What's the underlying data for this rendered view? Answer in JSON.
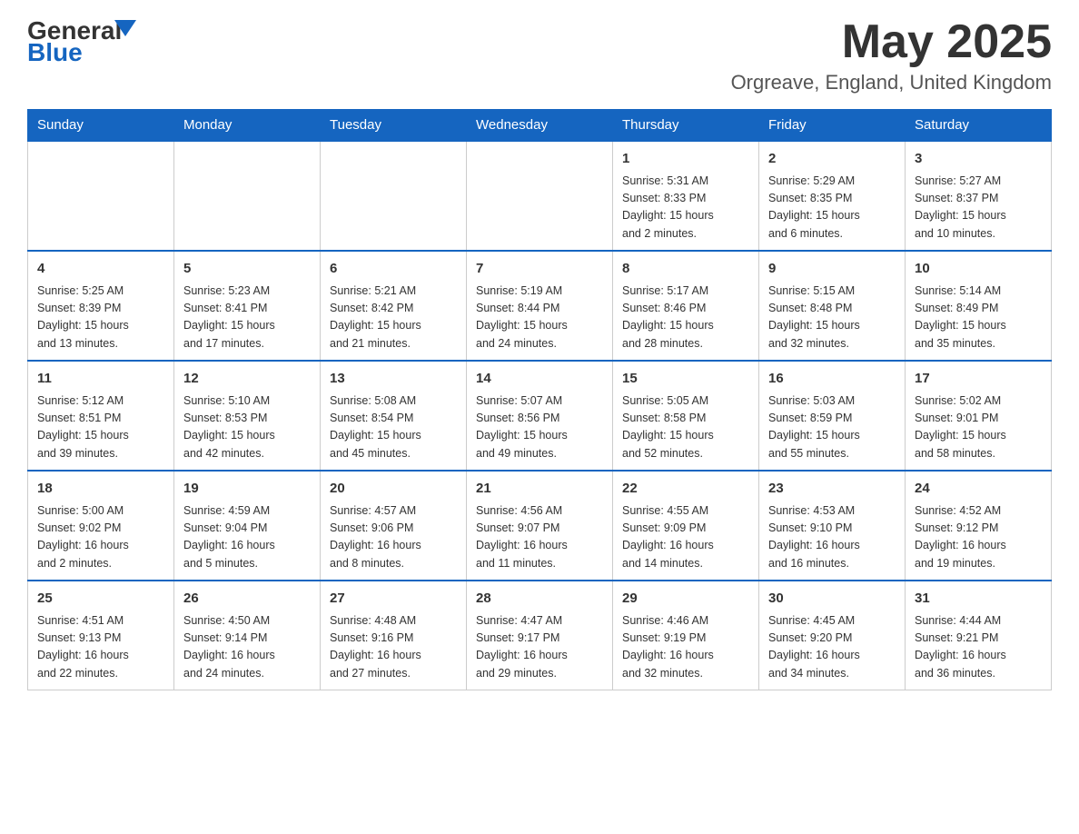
{
  "header": {
    "logo_general": "General",
    "logo_blue": "Blue",
    "month_title": "May 2025",
    "location": "Orgreave, England, United Kingdom"
  },
  "days_of_week": [
    "Sunday",
    "Monday",
    "Tuesday",
    "Wednesday",
    "Thursday",
    "Friday",
    "Saturday"
  ],
  "weeks": [
    [
      {
        "day": "",
        "info": ""
      },
      {
        "day": "",
        "info": ""
      },
      {
        "day": "",
        "info": ""
      },
      {
        "day": "",
        "info": ""
      },
      {
        "day": "1",
        "info": "Sunrise: 5:31 AM\nSunset: 8:33 PM\nDaylight: 15 hours\nand 2 minutes."
      },
      {
        "day": "2",
        "info": "Sunrise: 5:29 AM\nSunset: 8:35 PM\nDaylight: 15 hours\nand 6 minutes."
      },
      {
        "day": "3",
        "info": "Sunrise: 5:27 AM\nSunset: 8:37 PM\nDaylight: 15 hours\nand 10 minutes."
      }
    ],
    [
      {
        "day": "4",
        "info": "Sunrise: 5:25 AM\nSunset: 8:39 PM\nDaylight: 15 hours\nand 13 minutes."
      },
      {
        "day": "5",
        "info": "Sunrise: 5:23 AM\nSunset: 8:41 PM\nDaylight: 15 hours\nand 17 minutes."
      },
      {
        "day": "6",
        "info": "Sunrise: 5:21 AM\nSunset: 8:42 PM\nDaylight: 15 hours\nand 21 minutes."
      },
      {
        "day": "7",
        "info": "Sunrise: 5:19 AM\nSunset: 8:44 PM\nDaylight: 15 hours\nand 24 minutes."
      },
      {
        "day": "8",
        "info": "Sunrise: 5:17 AM\nSunset: 8:46 PM\nDaylight: 15 hours\nand 28 minutes."
      },
      {
        "day": "9",
        "info": "Sunrise: 5:15 AM\nSunset: 8:48 PM\nDaylight: 15 hours\nand 32 minutes."
      },
      {
        "day": "10",
        "info": "Sunrise: 5:14 AM\nSunset: 8:49 PM\nDaylight: 15 hours\nand 35 minutes."
      }
    ],
    [
      {
        "day": "11",
        "info": "Sunrise: 5:12 AM\nSunset: 8:51 PM\nDaylight: 15 hours\nand 39 minutes."
      },
      {
        "day": "12",
        "info": "Sunrise: 5:10 AM\nSunset: 8:53 PM\nDaylight: 15 hours\nand 42 minutes."
      },
      {
        "day": "13",
        "info": "Sunrise: 5:08 AM\nSunset: 8:54 PM\nDaylight: 15 hours\nand 45 minutes."
      },
      {
        "day": "14",
        "info": "Sunrise: 5:07 AM\nSunset: 8:56 PM\nDaylight: 15 hours\nand 49 minutes."
      },
      {
        "day": "15",
        "info": "Sunrise: 5:05 AM\nSunset: 8:58 PM\nDaylight: 15 hours\nand 52 minutes."
      },
      {
        "day": "16",
        "info": "Sunrise: 5:03 AM\nSunset: 8:59 PM\nDaylight: 15 hours\nand 55 minutes."
      },
      {
        "day": "17",
        "info": "Sunrise: 5:02 AM\nSunset: 9:01 PM\nDaylight: 15 hours\nand 58 minutes."
      }
    ],
    [
      {
        "day": "18",
        "info": "Sunrise: 5:00 AM\nSunset: 9:02 PM\nDaylight: 16 hours\nand 2 minutes."
      },
      {
        "day": "19",
        "info": "Sunrise: 4:59 AM\nSunset: 9:04 PM\nDaylight: 16 hours\nand 5 minutes."
      },
      {
        "day": "20",
        "info": "Sunrise: 4:57 AM\nSunset: 9:06 PM\nDaylight: 16 hours\nand 8 minutes."
      },
      {
        "day": "21",
        "info": "Sunrise: 4:56 AM\nSunset: 9:07 PM\nDaylight: 16 hours\nand 11 minutes."
      },
      {
        "day": "22",
        "info": "Sunrise: 4:55 AM\nSunset: 9:09 PM\nDaylight: 16 hours\nand 14 minutes."
      },
      {
        "day": "23",
        "info": "Sunrise: 4:53 AM\nSunset: 9:10 PM\nDaylight: 16 hours\nand 16 minutes."
      },
      {
        "day": "24",
        "info": "Sunrise: 4:52 AM\nSunset: 9:12 PM\nDaylight: 16 hours\nand 19 minutes."
      }
    ],
    [
      {
        "day": "25",
        "info": "Sunrise: 4:51 AM\nSunset: 9:13 PM\nDaylight: 16 hours\nand 22 minutes."
      },
      {
        "day": "26",
        "info": "Sunrise: 4:50 AM\nSunset: 9:14 PM\nDaylight: 16 hours\nand 24 minutes."
      },
      {
        "day": "27",
        "info": "Sunrise: 4:48 AM\nSunset: 9:16 PM\nDaylight: 16 hours\nand 27 minutes."
      },
      {
        "day": "28",
        "info": "Sunrise: 4:47 AM\nSunset: 9:17 PM\nDaylight: 16 hours\nand 29 minutes."
      },
      {
        "day": "29",
        "info": "Sunrise: 4:46 AM\nSunset: 9:19 PM\nDaylight: 16 hours\nand 32 minutes."
      },
      {
        "day": "30",
        "info": "Sunrise: 4:45 AM\nSunset: 9:20 PM\nDaylight: 16 hours\nand 34 minutes."
      },
      {
        "day": "31",
        "info": "Sunrise: 4:44 AM\nSunset: 9:21 PM\nDaylight: 16 hours\nand 36 minutes."
      }
    ]
  ]
}
